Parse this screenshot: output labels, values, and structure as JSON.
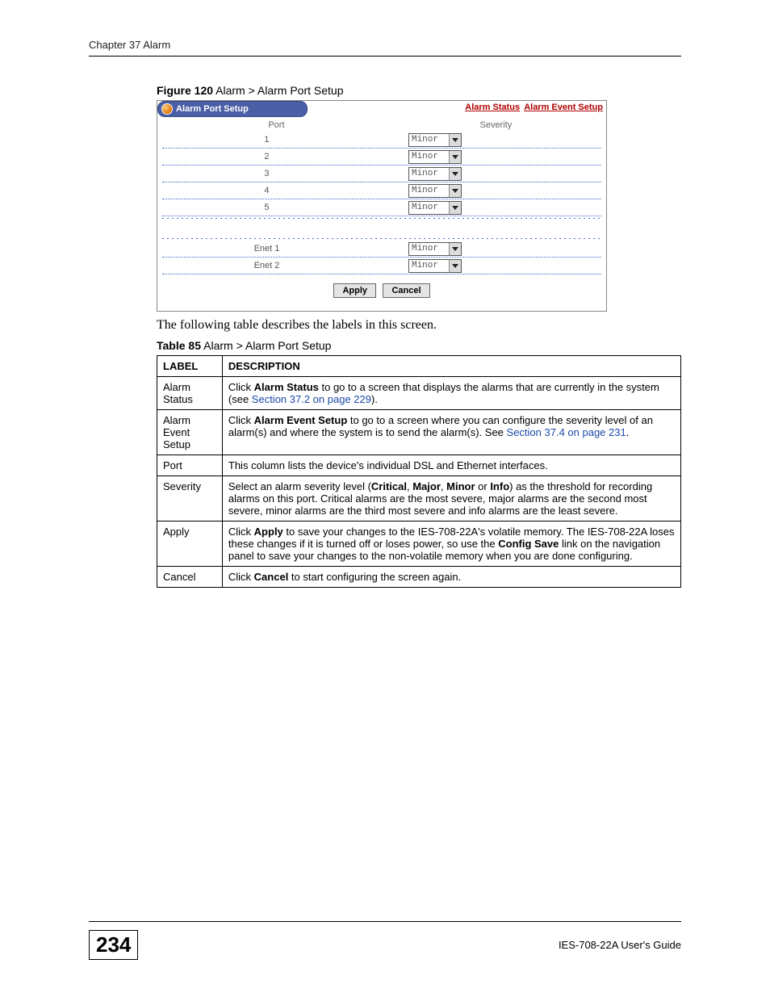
{
  "running_head": "Chapter 37 Alarm",
  "figure": {
    "caption_bold": "Figure 120",
    "caption_rest": "   Alarm > Alarm Port Setup",
    "pill_title": "Alarm Port Setup",
    "link1": "Alarm Status",
    "link2": "Alarm Event Setup",
    "col_port": "Port",
    "col_sev": "Severity",
    "rows_top": [
      {
        "port": "1",
        "sev": "Minor"
      },
      {
        "port": "2",
        "sev": "Minor"
      },
      {
        "port": "3",
        "sev": "Minor"
      },
      {
        "port": "4",
        "sev": "Minor"
      },
      {
        "port": "5",
        "sev": "Minor"
      }
    ],
    "rows_bottom": [
      {
        "port": "Enet 1",
        "sev": "Minor"
      },
      {
        "port": "Enet 2",
        "sev": "Minor"
      }
    ],
    "btn_apply": "Apply",
    "btn_cancel": "Cancel"
  },
  "intro": "The following table describes the labels in this screen.",
  "table_caption_bold": "Table 85",
  "table_caption_rest": "   Alarm > Alarm Port Setup",
  "table": {
    "h1": "LABEL",
    "h2": "DESCRIPTION",
    "rows": [
      {
        "label": "Alarm Status",
        "desc_pre": "Click ",
        "desc_bold": "Alarm Status",
        "desc_post": " to go to a screen that displays the alarms that are currently in the system (see ",
        "link": "Section 37.2 on page 229",
        "desc_tail": ")."
      },
      {
        "label": "Alarm Event Setup",
        "desc_pre": "Click ",
        "desc_bold": "Alarm Event Setup",
        "desc_post": " to go to a screen where you can configure the severity level of an alarm(s) and where the system is to send the alarm(s). See ",
        "link": "Section 37.4 on page 231",
        "desc_tail": "."
      },
      {
        "label": "Port",
        "plain": "This column lists the device's individual DSL and Ethernet interfaces."
      },
      {
        "label": "Severity",
        "sev_pre": "Select an alarm severity level (",
        "sev_b1": "Critical",
        "sev_c1": ", ",
        "sev_b2": "Major",
        "sev_c2": ", ",
        "sev_b3": "Minor",
        "sev_c3": " or ",
        "sev_b4": "Info",
        "sev_post": ") as the threshold for recording alarms on this port. Critical alarms are the most severe, major alarms are the second most severe, minor alarms are the third most severe and info alarms are the least severe."
      },
      {
        "label": "Apply",
        "apply_pre": "Click ",
        "apply_b1": "Apply",
        "apply_mid": " to save your changes to the IES-708-22A's volatile memory. The IES-708-22A loses these changes if it is turned off or loses power, so use the ",
        "apply_b2": "Config Save",
        "apply_post": " link on the navigation panel to save your changes to the non-volatile memory when you are done configuring."
      },
      {
        "label": "Cancel",
        "cancel_pre": "Click ",
        "cancel_b": "Cancel",
        "cancel_post": " to start configuring the screen again."
      }
    ]
  },
  "footer": {
    "page": "234",
    "guide": "IES-708-22A User's Guide"
  }
}
